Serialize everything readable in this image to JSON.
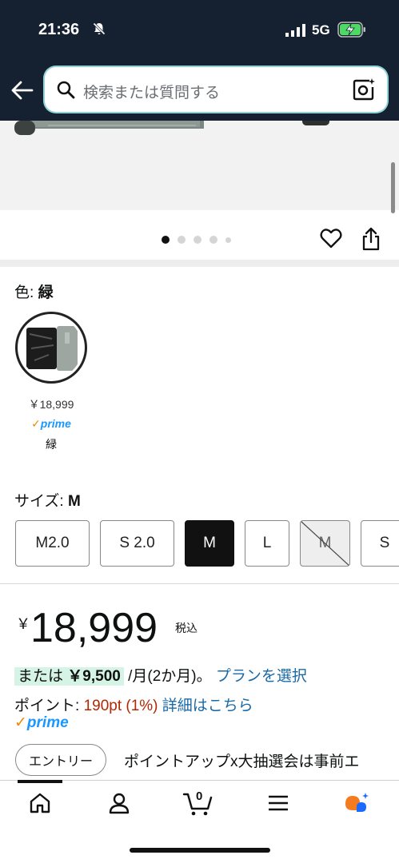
{
  "status_bar": {
    "time": "21:36",
    "network": "5G"
  },
  "search": {
    "placeholder": "検索または質問する"
  },
  "gallery": {
    "dots_total": 5,
    "active_dot": 1
  },
  "color": {
    "label": "色: ",
    "value": "緑",
    "swatch": {
      "price": "￥18,999",
      "prime_check": "✓",
      "prime": "prime",
      "name": "緑"
    }
  },
  "size": {
    "label": "サイズ: ",
    "value": "M",
    "options": [
      {
        "label": "M2.0",
        "state": "normal"
      },
      {
        "label": "S 2.0",
        "state": "normal"
      },
      {
        "label": "M",
        "state": "selected"
      },
      {
        "label": "L",
        "state": "normal"
      },
      {
        "label": "M",
        "state": "unavailable"
      },
      {
        "label": "S",
        "state": "normal"
      }
    ]
  },
  "price": {
    "currency": "￥",
    "value": "18,999",
    "tax_label": "税込",
    "installment_prefix": "または ",
    "installment_amount": "￥9,500",
    "installment_suffix": " /月(2か月)。",
    "installment_link": "プランを選択",
    "points_label": "ポイント: ",
    "points_value": "190pt",
    "points_rate": "(1%)",
    "points_link": "詳細はこちら",
    "prime_check": "✓",
    "prime": "prime"
  },
  "promo": {
    "entry_label": "エントリー",
    "text": "ポイントアップx大抽選会は事前エ"
  },
  "bottom_nav": {
    "items": [
      "home-icon",
      "account-icon",
      "cart-icon",
      "menu-icon",
      "assistant-icon"
    ],
    "cart_count": "0"
  },
  "colors": {
    "header": "#152031",
    "link": "#1a6aa8",
    "red": "#b12704",
    "prime": "#1a98ff",
    "highlight": "#d5f4e5"
  }
}
